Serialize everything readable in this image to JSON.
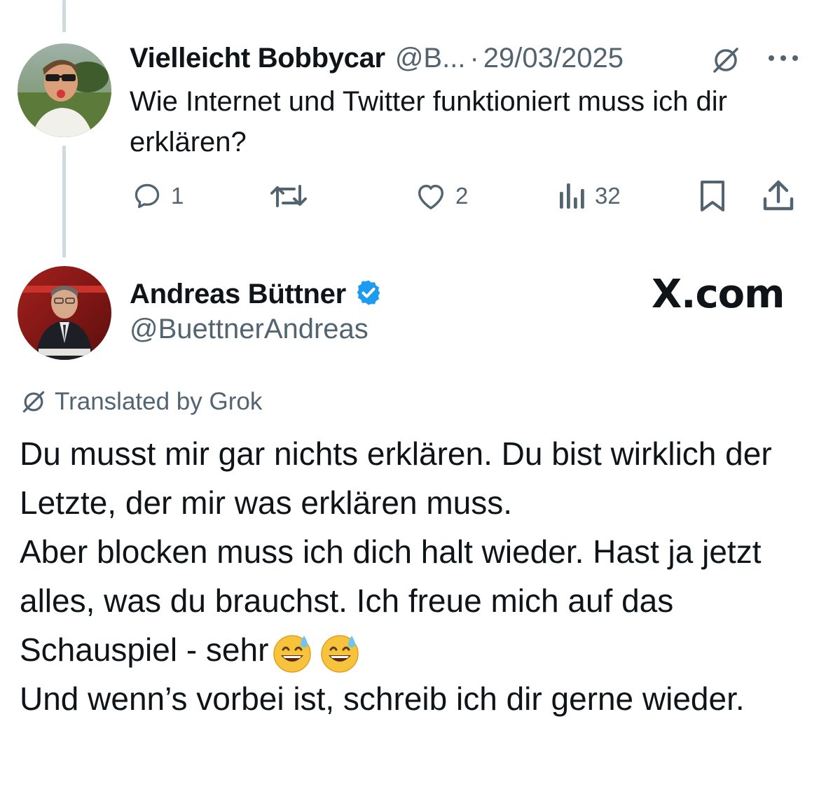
{
  "reply": {
    "name": "Vielleicht Bobbycar",
    "handle": "@B...",
    "separator": "·",
    "date": "29/03/2025",
    "text": "Wie Internet und Twitter funktioniert muss ich dir erklären?",
    "actions": {
      "replies": "1",
      "reposts": "",
      "likes": "2",
      "views": "32"
    }
  },
  "main": {
    "name": "Andreas Büttner",
    "handle": "@BuettnerAndreas",
    "watermark": "X.com",
    "translated_label": "Translated by Grok",
    "lines": [
      "Du musst mir gar nichts erklären. Du bist wirklich der Letzte, der mir was erklären muss.",
      "Aber blocken muss ich dich halt wieder. Hast ja jetzt alles, was du brauchst. Ich freue mich auf das Schauspiel - sehr",
      "Und wenn’s vorbei ist, schreib ich dir gerne wieder."
    ]
  },
  "icons": {
    "verified_color": "#1d9bf0",
    "muted_color": "#536471",
    "thread_line_color": "#cfd9de"
  }
}
